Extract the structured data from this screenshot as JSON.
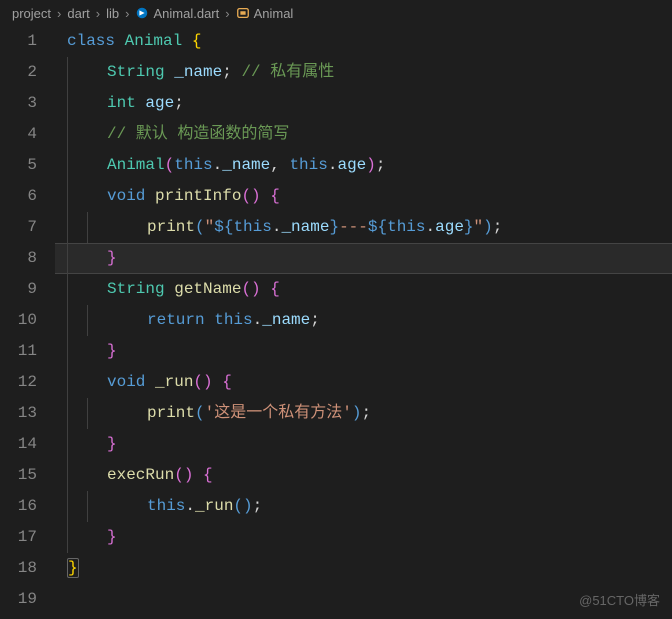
{
  "breadcrumb": {
    "items": [
      {
        "label": "project",
        "icon": null
      },
      {
        "label": "dart",
        "icon": null
      },
      {
        "label": "lib",
        "icon": null
      },
      {
        "label": "Animal.dart",
        "icon": "dart-file-icon"
      },
      {
        "label": "Animal",
        "icon": "class-icon"
      }
    ],
    "separator": "›"
  },
  "editor": {
    "active_line": 8,
    "lines": [
      {
        "n": 1,
        "indent": 0,
        "tokens": [
          {
            "t": "class ",
            "c": "tk-keyword"
          },
          {
            "t": "Animal ",
            "c": "tk-class"
          },
          {
            "t": "{",
            "c": "tk-brace"
          }
        ]
      },
      {
        "n": 2,
        "indent": 1,
        "tokens": [
          {
            "t": "String ",
            "c": "tk-type"
          },
          {
            "t": "_name",
            "c": "tk-var"
          },
          {
            "t": "; ",
            "c": "tk-punc"
          },
          {
            "t": "// 私有属性",
            "c": "tk-comment"
          }
        ]
      },
      {
        "n": 3,
        "indent": 1,
        "tokens": [
          {
            "t": "int ",
            "c": "tk-type"
          },
          {
            "t": "age",
            "c": "tk-var"
          },
          {
            "t": ";",
            "c": "tk-punc"
          }
        ]
      },
      {
        "n": 4,
        "indent": 1,
        "tokens": [
          {
            "t": "// 默认 构造函数的简写",
            "c": "tk-comment"
          }
        ]
      },
      {
        "n": 5,
        "indent": 1,
        "tokens": [
          {
            "t": "Animal",
            "c": "tk-class"
          },
          {
            "t": "(",
            "c": "tk-brace-pink"
          },
          {
            "t": "this",
            "c": "tk-keyword"
          },
          {
            "t": ".",
            "c": "tk-punc"
          },
          {
            "t": "_name",
            "c": "tk-prop"
          },
          {
            "t": ", ",
            "c": "tk-punc"
          },
          {
            "t": "this",
            "c": "tk-keyword"
          },
          {
            "t": ".",
            "c": "tk-punc"
          },
          {
            "t": "age",
            "c": "tk-prop"
          },
          {
            "t": ")",
            "c": "tk-brace-pink"
          },
          {
            "t": ";",
            "c": "tk-punc"
          }
        ]
      },
      {
        "n": 6,
        "indent": 1,
        "tokens": [
          {
            "t": "void ",
            "c": "tk-keyword"
          },
          {
            "t": "printInfo",
            "c": "tk-func"
          },
          {
            "t": "()",
            "c": "tk-brace-pink"
          },
          {
            "t": " ",
            "c": ""
          },
          {
            "t": "{",
            "c": "tk-brace-pink"
          }
        ]
      },
      {
        "n": 7,
        "indent": 2,
        "tokens": [
          {
            "t": "print",
            "c": "tk-func"
          },
          {
            "t": "(",
            "c": "tk-interp"
          },
          {
            "t": "\"",
            "c": "tk-string"
          },
          {
            "t": "${",
            "c": "tk-interp"
          },
          {
            "t": "this",
            "c": "tk-keyword"
          },
          {
            "t": ".",
            "c": "tk-punc"
          },
          {
            "t": "_name",
            "c": "tk-prop"
          },
          {
            "t": "}",
            "c": "tk-interp"
          },
          {
            "t": "---",
            "c": "tk-string"
          },
          {
            "t": "${",
            "c": "tk-interp"
          },
          {
            "t": "this",
            "c": "tk-keyword"
          },
          {
            "t": ".",
            "c": "tk-punc"
          },
          {
            "t": "age",
            "c": "tk-prop"
          },
          {
            "t": "}",
            "c": "tk-interp"
          },
          {
            "t": "\"",
            "c": "tk-string"
          },
          {
            "t": ")",
            "c": "tk-interp"
          },
          {
            "t": ";",
            "c": "tk-punc"
          }
        ]
      },
      {
        "n": 8,
        "indent": 1,
        "tokens": [
          {
            "t": "}",
            "c": "tk-brace-pink"
          }
        ]
      },
      {
        "n": 9,
        "indent": 1,
        "tokens": [
          {
            "t": "String ",
            "c": "tk-type"
          },
          {
            "t": "getName",
            "c": "tk-func"
          },
          {
            "t": "()",
            "c": "tk-brace-pink"
          },
          {
            "t": " ",
            "c": ""
          },
          {
            "t": "{",
            "c": "tk-brace-pink"
          }
        ]
      },
      {
        "n": 10,
        "indent": 2,
        "tokens": [
          {
            "t": "return ",
            "c": "tk-keyword"
          },
          {
            "t": "this",
            "c": "tk-keyword"
          },
          {
            "t": ".",
            "c": "tk-punc"
          },
          {
            "t": "_name",
            "c": "tk-prop"
          },
          {
            "t": ";",
            "c": "tk-punc"
          }
        ]
      },
      {
        "n": 11,
        "indent": 1,
        "tokens": [
          {
            "t": "}",
            "c": "tk-brace-pink"
          }
        ]
      },
      {
        "n": 12,
        "indent": 1,
        "tokens": [
          {
            "t": "void ",
            "c": "tk-keyword"
          },
          {
            "t": "_run",
            "c": "tk-func"
          },
          {
            "t": "()",
            "c": "tk-brace-pink"
          },
          {
            "t": " ",
            "c": ""
          },
          {
            "t": "{",
            "c": "tk-brace-pink"
          }
        ]
      },
      {
        "n": 13,
        "indent": 2,
        "tokens": [
          {
            "t": "print",
            "c": "tk-func"
          },
          {
            "t": "(",
            "c": "tk-interp"
          },
          {
            "t": "'这是一个私有方法'",
            "c": "tk-string"
          },
          {
            "t": ")",
            "c": "tk-interp"
          },
          {
            "t": ";",
            "c": "tk-punc"
          }
        ]
      },
      {
        "n": 14,
        "indent": 1,
        "tokens": [
          {
            "t": "}",
            "c": "tk-brace-pink"
          }
        ]
      },
      {
        "n": 15,
        "indent": 1,
        "tokens": [
          {
            "t": "execRun",
            "c": "tk-func"
          },
          {
            "t": "()",
            "c": "tk-brace-pink"
          },
          {
            "t": " ",
            "c": ""
          },
          {
            "t": "{",
            "c": "tk-brace-pink"
          }
        ]
      },
      {
        "n": 16,
        "indent": 2,
        "tokens": [
          {
            "t": "this",
            "c": "tk-keyword"
          },
          {
            "t": ".",
            "c": "tk-punc"
          },
          {
            "t": "_run",
            "c": "tk-func"
          },
          {
            "t": "()",
            "c": "tk-interp"
          },
          {
            "t": ";",
            "c": "tk-punc"
          }
        ]
      },
      {
        "n": 17,
        "indent": 1,
        "tokens": [
          {
            "t": "}",
            "c": "tk-brace-pink"
          }
        ]
      },
      {
        "n": 18,
        "indent": 0,
        "tokens": [
          {
            "t": "}",
            "c": "tk-brace",
            "box": true
          }
        ]
      },
      {
        "n": 19,
        "indent": 0,
        "tokens": []
      }
    ]
  },
  "watermark": "@51CTO博客",
  "colors": {
    "background": "#1e1e1e",
    "gutter": "#858585",
    "keyword": "#569cd6",
    "type": "#4ec9b0",
    "variable": "#9cdcfe",
    "function": "#dcdcaa",
    "string": "#ce9178",
    "comment": "#6a9955",
    "brace_yellow": "#ffd700",
    "brace_pink": "#da70d6"
  }
}
